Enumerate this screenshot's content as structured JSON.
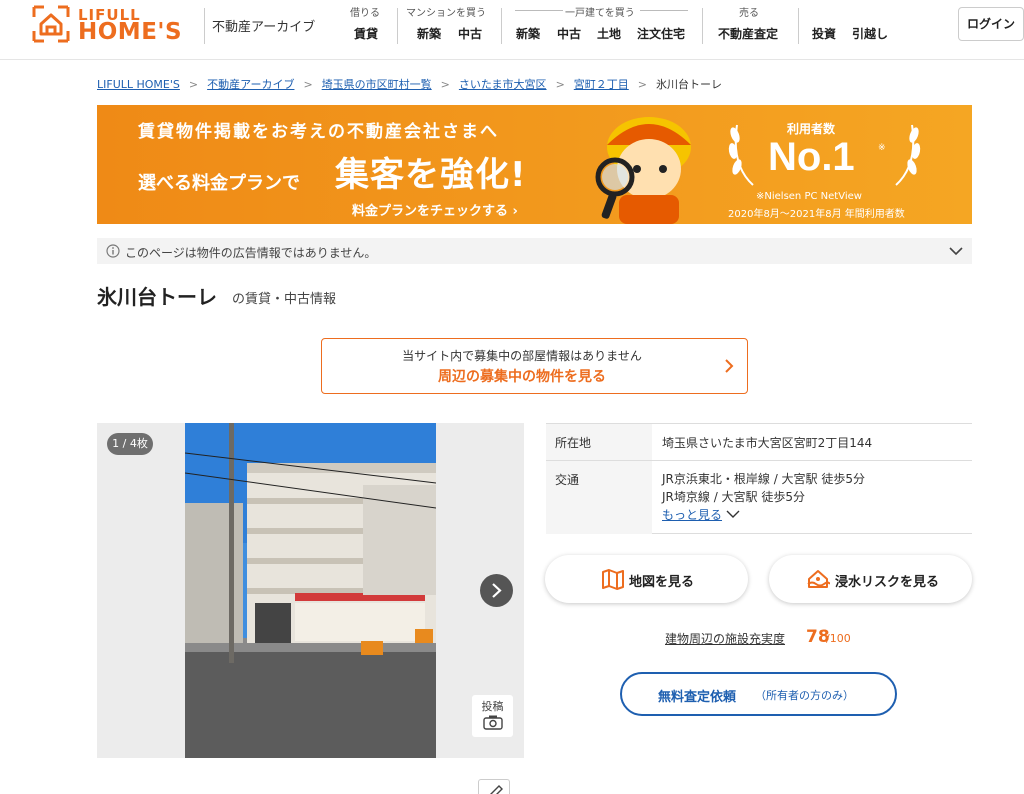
{
  "header": {
    "logo_top": "LIFULL",
    "logo_bottom": "HOME'S",
    "archive_label": "不動産アーカイブ",
    "groups": [
      {
        "label": "借りる",
        "items": [
          "賃貸"
        ]
      },
      {
        "label": "マンションを買う",
        "items": [
          "新築",
          "中古"
        ]
      },
      {
        "label": "一戸建てを買う",
        "items": [
          "新築",
          "中古",
          "土地",
          "注文住宅"
        ]
      },
      {
        "label": "売る",
        "items": [
          "不動産査定"
        ]
      },
      {
        "label": "",
        "items": [
          "投資",
          "引越し"
        ]
      }
    ],
    "login_label": "ログイン"
  },
  "breadcrumb": {
    "links": [
      "LIFULL HOME'S",
      "不動産アーカイブ",
      "埼玉県の市区町村一覧",
      "さいたま市大宮区",
      "宮町２丁目"
    ],
    "current": "氷川台トーレ"
  },
  "banner": {
    "line1": "賃貸物件掲載をお考えの不動産会社さまへ",
    "line2a": "選べる料金プランで",
    "line2b": "集客を強化!",
    "line3": "料金プランをチェックする ›",
    "rank_label": "利用者数",
    "rank_value": "No.1",
    "rank_mark": "※",
    "source": "※Nielsen PC NetView",
    "period": "2020年8月～2021年8月 年間利用者数",
    "color": "#f39317"
  },
  "notice": {
    "text": "このページは物件の広告情報ではありません。"
  },
  "property": {
    "name": "氷川台トーレ",
    "subtitle": "の賃貸・中古情報"
  },
  "callout": {
    "line1": "当サイト内で募集中の部屋情報はありません",
    "line2": "周辺の募集中の物件を見る"
  },
  "photo": {
    "counter": "1 / 4枚",
    "post_label": "投稿"
  },
  "info": {
    "address_key": "所在地",
    "address_value": "埼玉県さいたま市大宮区宮町2丁目144",
    "transit_key": "交通",
    "transit_lines": [
      "JR京浜東北・根岸線 / 大宮駅 徒歩5分",
      "JR埼京線 / 大宮駅 徒歩5分"
    ],
    "more_label": "もっと見る"
  },
  "actions": {
    "map_label": "地図を見る",
    "flood_label": "浸水リスクを見る"
  },
  "facility": {
    "label": "建物周辺の施設充実度",
    "score": "78",
    "max": "/100"
  },
  "assessment": {
    "main": "無料査定依頼",
    "sub": "（所有者の方のみ）"
  },
  "colors": {
    "brand": "#ed6d1f",
    "link": "#1e5fb0"
  }
}
